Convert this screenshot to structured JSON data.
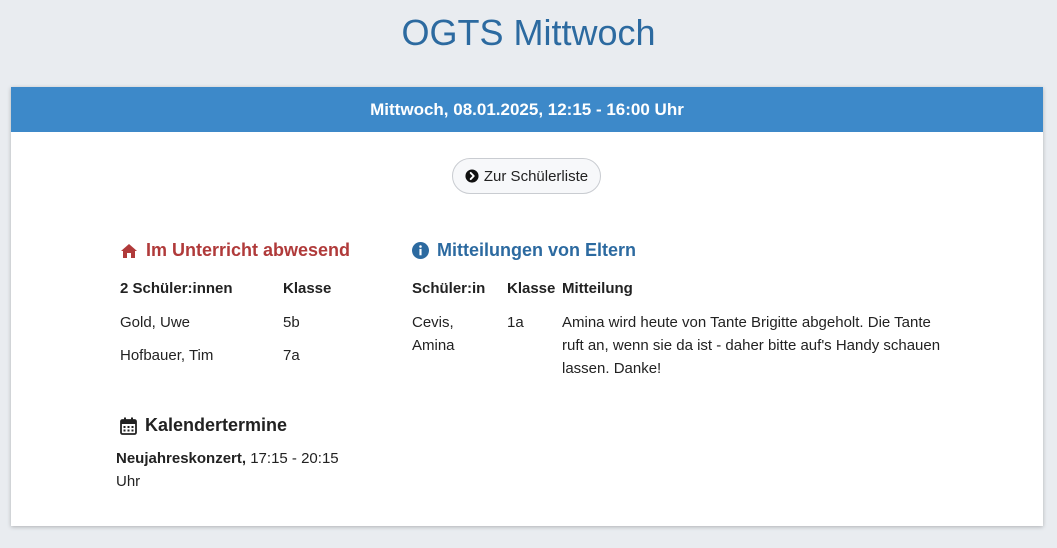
{
  "page": {
    "title": "OGTS Mittwoch"
  },
  "card": {
    "header": "Mittwoch, 08.01.2025, 12:15 - 16:00 Uhr",
    "button_label": "Zur Schülerliste"
  },
  "absent": {
    "title": "Im Unterricht abwesend",
    "columns": [
      "2 Schüler:innen",
      "Klasse"
    ],
    "rows": [
      {
        "name": "Gold, Uwe",
        "class": "5b"
      },
      {
        "name": "Hofbauer, Tim",
        "class": "7a"
      }
    ]
  },
  "messages": {
    "title": "Mitteilungen von Eltern",
    "columns": [
      "Schüler:in",
      "Klasse",
      "Mitteilung"
    ],
    "rows": [
      {
        "student": "Cevis, Amina",
        "class": "1a",
        "message": "Amina wird heute von Tante Brigitte abgeholt. Die Tante ruft an, wenn sie da ist - daher bitte auf's Handy schauen lassen. Danke!"
      }
    ]
  },
  "calendar": {
    "title": "Kalendertermine",
    "events": [
      {
        "name": "Neujahreskonzert,",
        "time": "17:15 - 20:15 Uhr"
      }
    ]
  },
  "colors": {
    "header": "#3d89c9",
    "title": "#2c6aa0",
    "absent": "#b03a3a"
  },
  "icons": {
    "button": "circle-arrow-right-icon",
    "absent": "home-icon",
    "messages": "info-circle-icon",
    "calendar": "calendar-icon"
  }
}
